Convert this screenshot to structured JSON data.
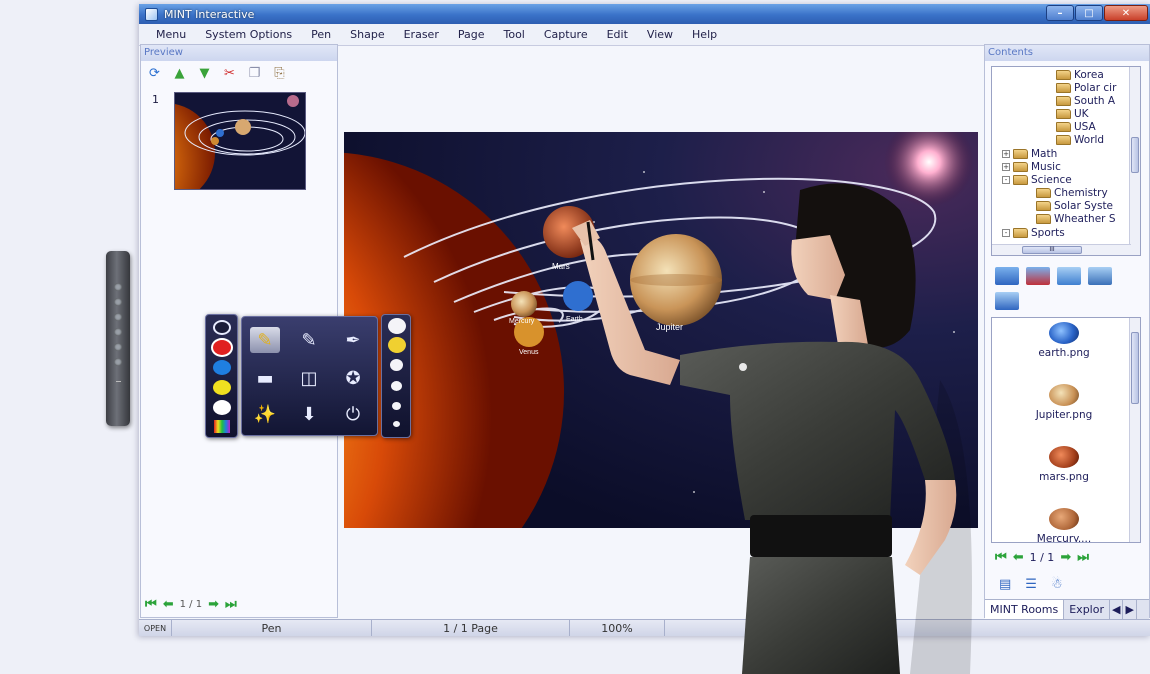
{
  "window": {
    "title": "MINT Interactive"
  },
  "menu": [
    "Menu",
    "System Options",
    "Pen",
    "Shape",
    "Eraser",
    "Page",
    "Tool",
    "Capture",
    "Edit",
    "View",
    "Help"
  ],
  "preview": {
    "title": "Preview",
    "toolbar_icons": [
      "refresh-icon",
      "move-up-icon",
      "move-down-icon",
      "cut-icon",
      "copy-icon",
      "paste-icon"
    ],
    "thumb_number": "1",
    "pager": "1 / 1"
  },
  "canvas": {
    "planet_labels": [
      "Mercury",
      "Venus",
      "Earth",
      "Mars",
      "Jupiter"
    ]
  },
  "contents": {
    "title": "Contents",
    "tree": [
      {
        "label": "Korea",
        "level": 2
      },
      {
        "label": "Polar cir",
        "level": 2
      },
      {
        "label": "South A",
        "level": 2
      },
      {
        "label": "UK",
        "level": 2
      },
      {
        "label": "USA",
        "level": 2
      },
      {
        "label": "World",
        "level": 2
      },
      {
        "label": "Math",
        "level": 1,
        "expander": "+"
      },
      {
        "label": "Music",
        "level": 1,
        "expander": "+"
      },
      {
        "label": "Science",
        "level": 1,
        "expander": "-"
      },
      {
        "label": "Chemistry",
        "level": 2
      },
      {
        "label": "Solar Syste",
        "level": 2
      },
      {
        "label": "Wheather S",
        "level": 2
      },
      {
        "label": "Sports",
        "level": 1,
        "expander": "-"
      }
    ],
    "tree_hscroll_label": "III",
    "files": [
      {
        "name": "earth.png",
        "color": "#2a64c8"
      },
      {
        "name": "Jupiter.png",
        "color": "#c89054"
      },
      {
        "name": "mars.png",
        "color": "#a4401c"
      },
      {
        "name": "Mercury....",
        "color": "#b0683a"
      }
    ],
    "pager": "1 / 1",
    "tabs": [
      "MINT Rooms",
      "Explor"
    ]
  },
  "palette": {
    "colors": [
      "#1b1d3a",
      "#e02020",
      "#1f7fe0",
      "#f0e020",
      "#ffffff"
    ],
    "tools": [
      "highlighter-icon",
      "pen-icon",
      "pen-alt-icon",
      "eraser-icon",
      "wide-eraser-icon",
      "star-icon",
      "effect-pen-icon",
      "download-icon",
      "power-icon"
    ]
  },
  "statusbar": {
    "mode": "OPEN",
    "tool": "Pen",
    "page": "1 / 1 Page",
    "zoom": "100%"
  },
  "colors": {
    "titlebar": "#3a72c8",
    "pager_arrows": "#2ba33a",
    "panel_title": "#5a78c4"
  }
}
